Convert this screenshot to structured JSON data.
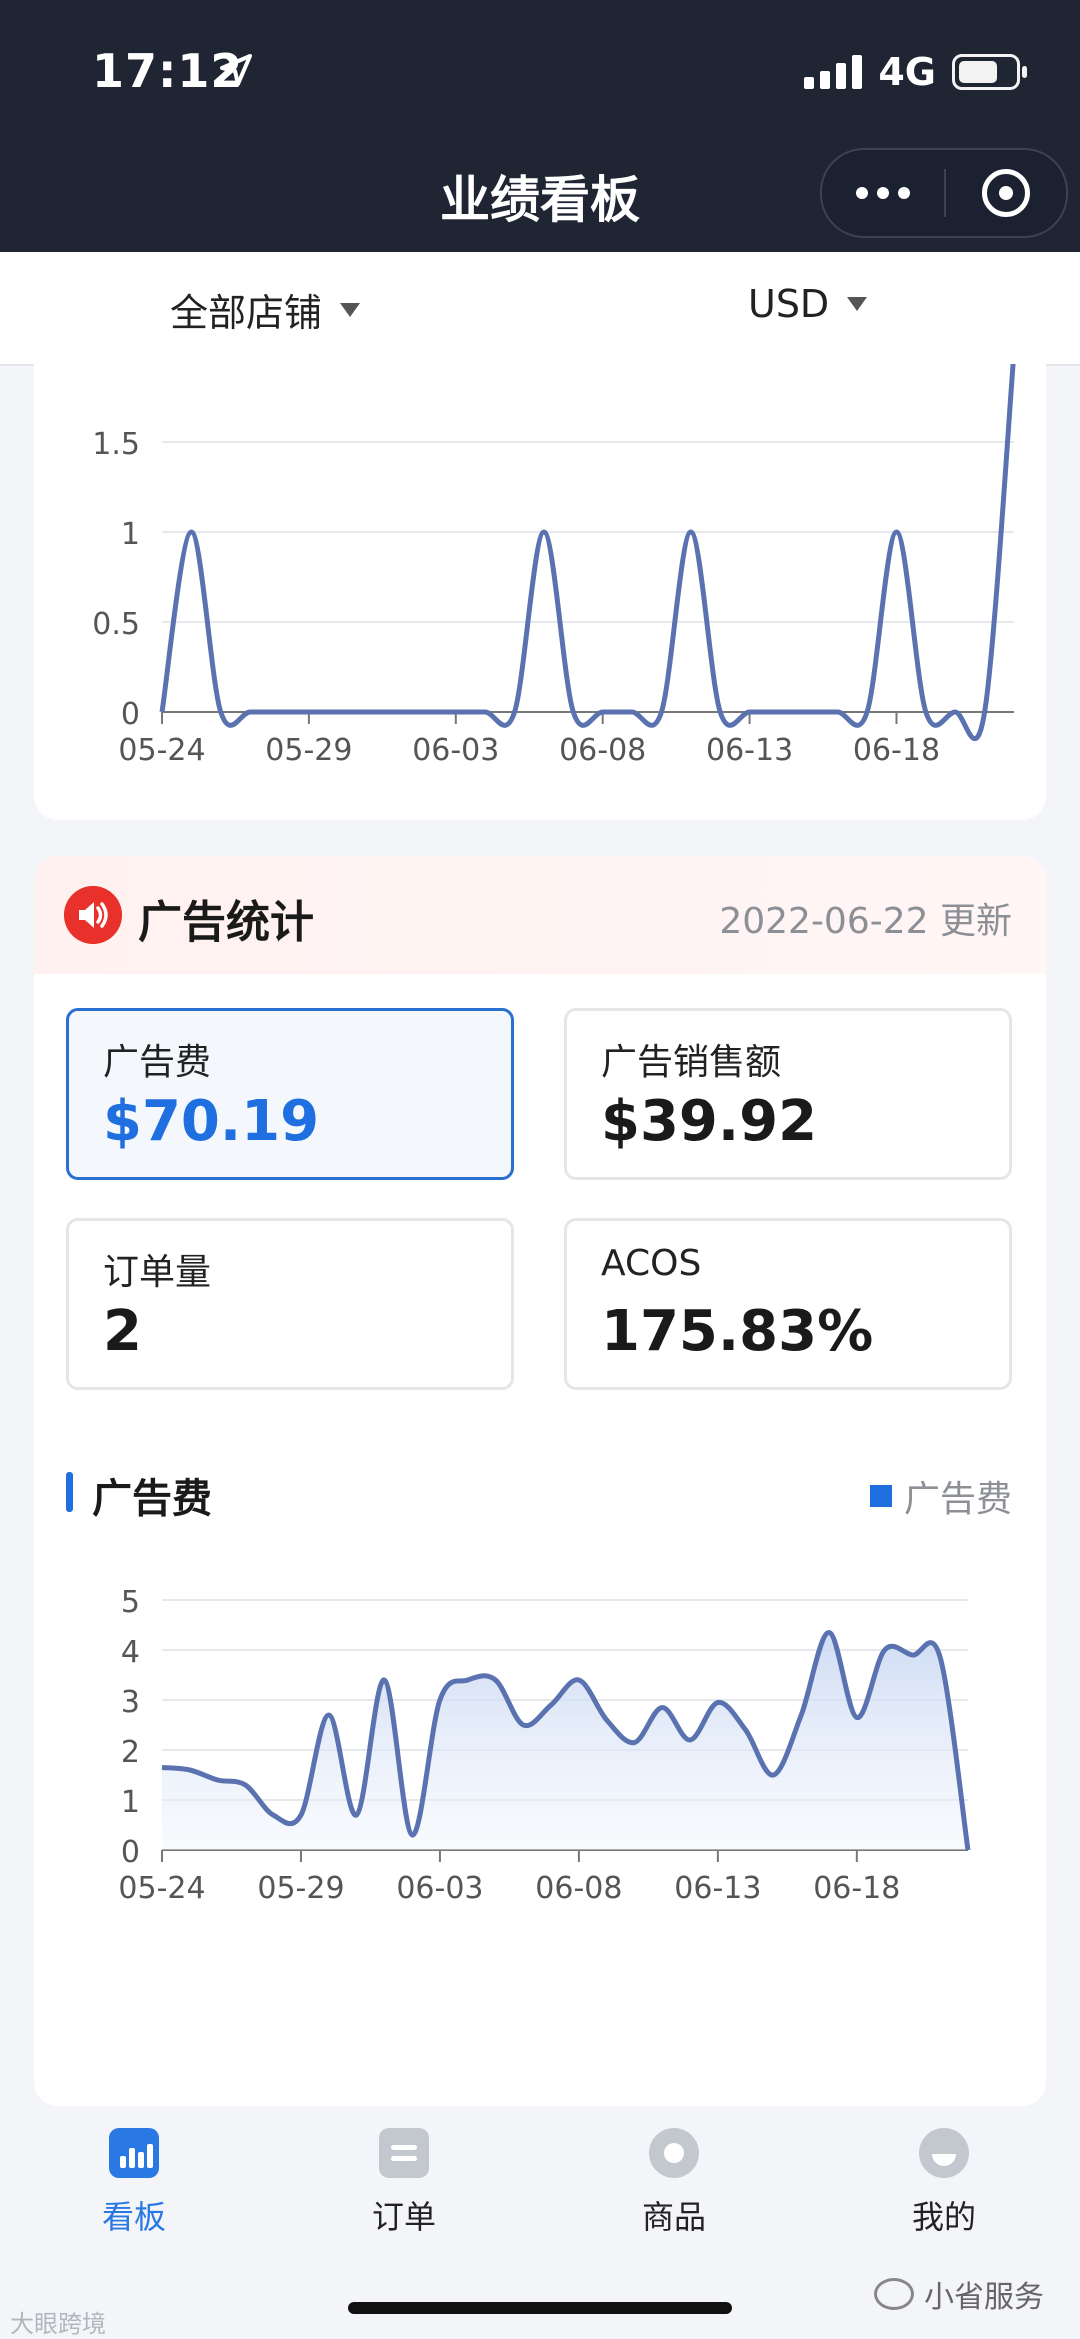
{
  "status": {
    "time": "17:12",
    "network": "4G"
  },
  "nav": {
    "title": "业绩看板"
  },
  "filters": {
    "store": "全部店铺",
    "currency": "USD"
  },
  "colors": {
    "accent": "#1f6fe0",
    "line": "#5a73b0",
    "header_bg": "#1f2533",
    "ad_icon": "#e8312a"
  },
  "orders_chart": {
    "chart_data": {
      "type": "line",
      "x": [
        "05-24",
        "05-25",
        "05-26",
        "05-27",
        "05-28",
        "05-29",
        "05-30",
        "05-31",
        "06-01",
        "06-02",
        "06-03",
        "06-04",
        "06-05",
        "06-06",
        "06-07",
        "06-08",
        "06-09",
        "06-10",
        "06-11",
        "06-12",
        "06-13",
        "06-14",
        "06-15",
        "06-16",
        "06-17",
        "06-18",
        "06-19",
        "06-20",
        "06-21",
        "06-22"
      ],
      "values": [
        0,
        1,
        0,
        0,
        0,
        0,
        0,
        0,
        0,
        0,
        0,
        0,
        0,
        1,
        0,
        0,
        0,
        0,
        1,
        0,
        0,
        0,
        0,
        0,
        0,
        1,
        0,
        0,
        0,
        2
      ],
      "x_ticks": [
        "05-24",
        "05-29",
        "06-03",
        "06-08",
        "06-13",
        "06-18"
      ],
      "y_ticks": [
        "0",
        "0.5",
        "1",
        "1.5"
      ],
      "ylim": [
        0,
        1.8
      ],
      "grid": true
    }
  },
  "ad": {
    "title": "广告统计",
    "updated": "2022-06-22 更新",
    "stats": [
      {
        "label": "广告费",
        "value": "$70.19",
        "active": true
      },
      {
        "label": "广告销售额",
        "value": "$39.92",
        "active": false
      },
      {
        "label": "订单量",
        "value": "2",
        "active": false
      },
      {
        "label": "ACOS",
        "value": "175.83%",
        "active": false
      }
    ],
    "section_title": "广告费",
    "legend": "广告费"
  },
  "ad_chart": {
    "chart_data": {
      "type": "area",
      "x": [
        "05-24",
        "05-25",
        "05-26",
        "05-27",
        "05-28",
        "05-29",
        "05-30",
        "05-31",
        "06-01",
        "06-02",
        "06-03",
        "06-04",
        "06-05",
        "06-06",
        "06-07",
        "06-08",
        "06-09",
        "06-10",
        "06-11",
        "06-12",
        "06-13",
        "06-14",
        "06-15",
        "06-16",
        "06-17",
        "06-18",
        "06-19",
        "06-20",
        "06-21",
        "06-22"
      ],
      "series": [
        {
          "values": [
            1.65,
            1.6,
            1.4,
            1.3,
            0.7,
            0.7,
            2.7,
            0.7,
            3.4,
            0.3,
            3.0,
            3.4,
            3.4,
            2.5,
            2.9,
            3.4,
            2.6,
            2.15,
            2.85,
            2.2,
            2.95,
            2.4,
            1.5,
            2.7,
            4.35,
            2.65,
            4.0,
            3.9,
            3.85,
            0
          ]
        }
      ],
      "x_ticks": [
        "05-24",
        "05-29",
        "06-03",
        "06-08",
        "06-13",
        "06-18"
      ],
      "y_ticks": [
        "0",
        "1",
        "2",
        "3",
        "4",
        "5"
      ],
      "ylim": [
        0,
        5
      ],
      "grid": true
    }
  },
  "tabs": [
    {
      "label": "看板",
      "icon": "dashboard-icon",
      "active": true
    },
    {
      "label": "订单",
      "icon": "order-icon",
      "active": false
    },
    {
      "label": "商品",
      "icon": "goods-icon",
      "active": false
    },
    {
      "label": "我的",
      "icon": "profile-icon",
      "active": false
    }
  ],
  "watermarks": {
    "left": "大眼跨境",
    "right": "小省服务"
  }
}
